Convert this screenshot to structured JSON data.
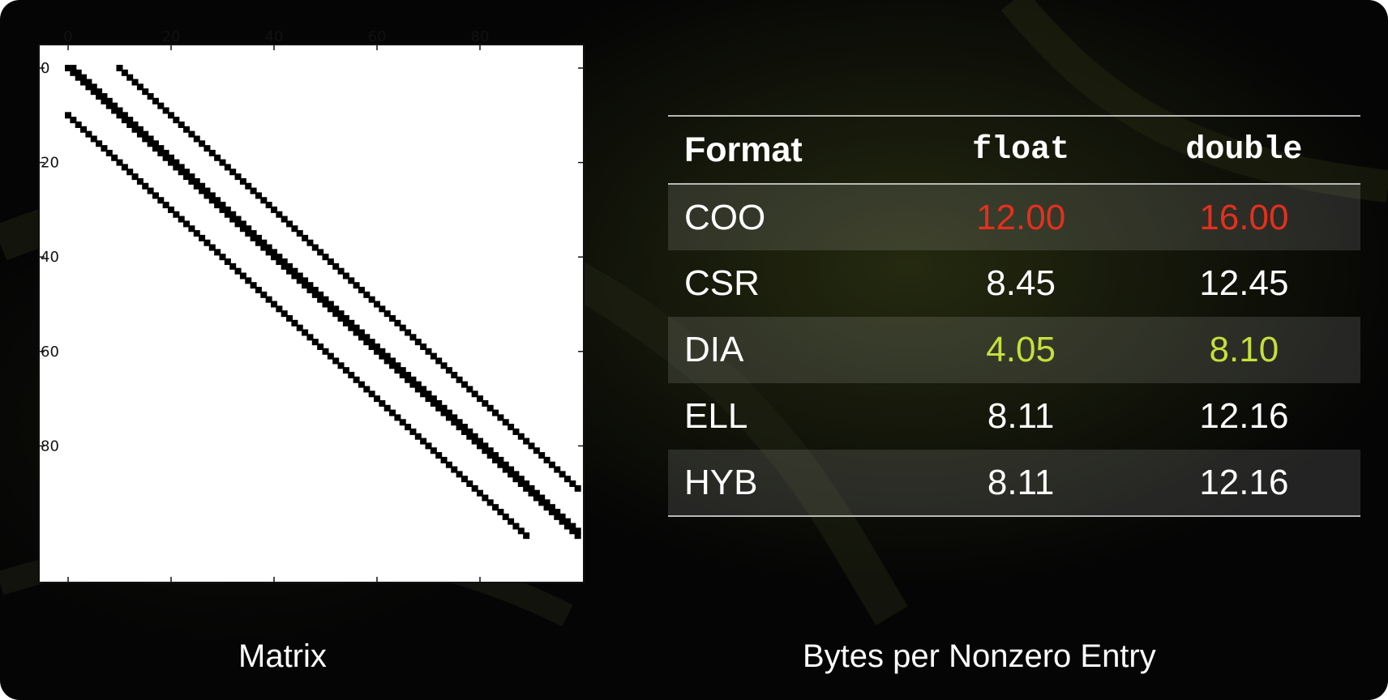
{
  "slide": {
    "background": "#050505",
    "accent_green": "#c5df3b",
    "highlight_red": "#e3301f"
  },
  "chart_data": {
    "type": "heatmap",
    "description_label": "Matrix",
    "xlim": [
      0,
      99
    ],
    "ylim": [
      99,
      0
    ],
    "x_ticks": [
      0,
      20,
      40,
      60,
      80
    ],
    "y_ticks": [
      0,
      20,
      40,
      60,
      80
    ],
    "x_tick_position": "top",
    "matrix_size": 100,
    "nonzero_diagonal_offsets": [
      -10,
      0,
      1,
      10
    ],
    "colors": {
      "nonzero": "#000000",
      "zero": "#ffffff"
    }
  },
  "captions": {
    "left": "Matrix",
    "right": "Bytes per Nonzero Entry"
  },
  "table": {
    "headers": {
      "format": "Format",
      "float": "float",
      "double": "double"
    },
    "rows": [
      {
        "format": "COO",
        "float": "12.00",
        "double": "16.00",
        "highlight": "red"
      },
      {
        "format": "CSR",
        "float": "8.45",
        "double": "12.45",
        "highlight": "none"
      },
      {
        "format": "DIA",
        "float": "4.05",
        "double": "8.10",
        "highlight": "green"
      },
      {
        "format": "ELL",
        "float": "8.11",
        "double": "12.16",
        "highlight": "none"
      },
      {
        "format": "HYB",
        "float": "8.11",
        "double": "12.16",
        "highlight": "none"
      }
    ]
  }
}
